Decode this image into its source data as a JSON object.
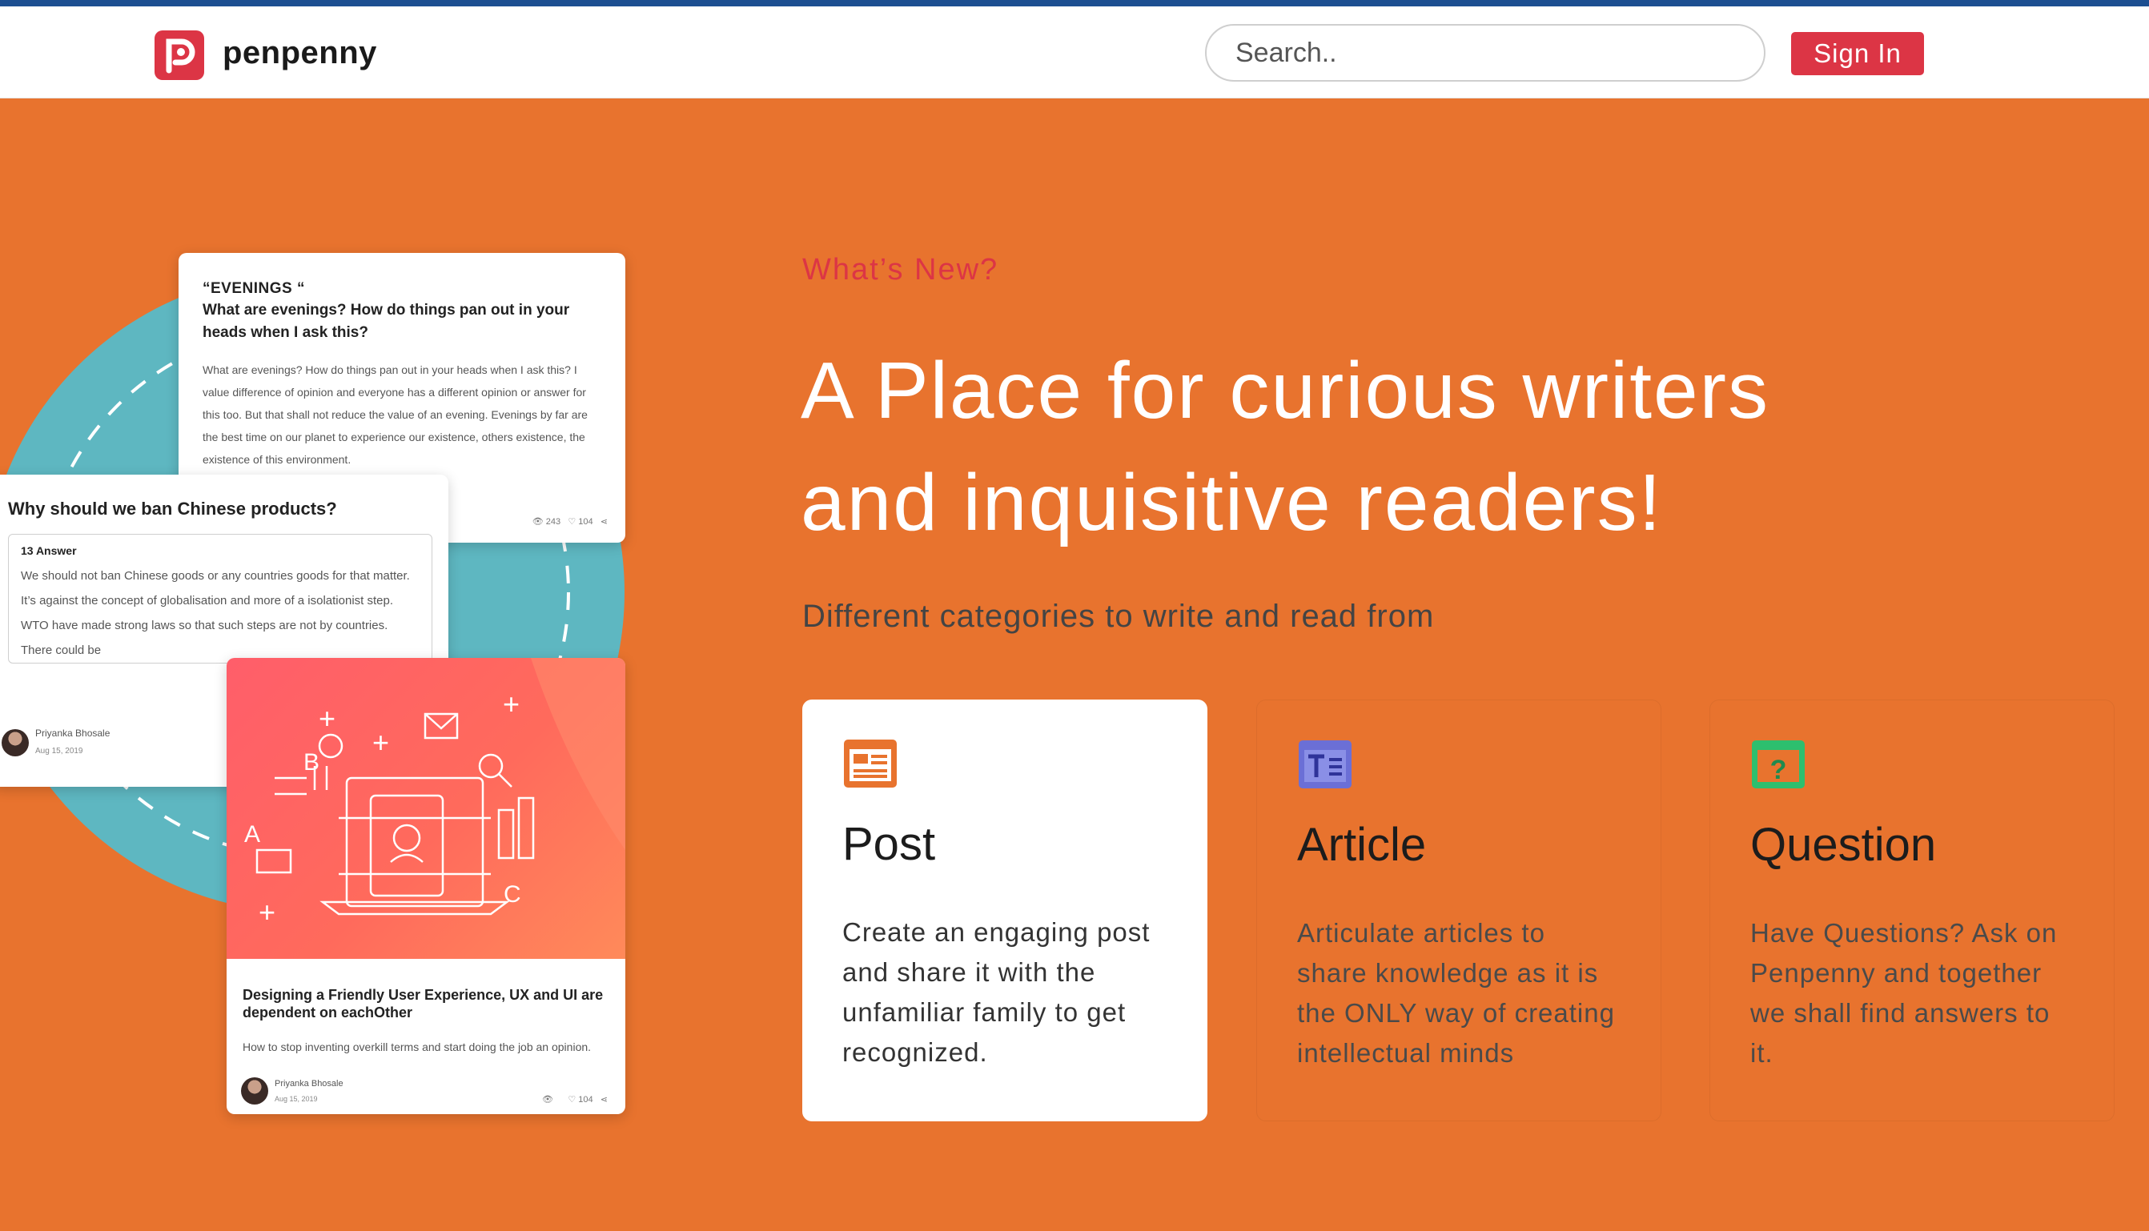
{
  "navbar": {
    "brand": "penpenny",
    "search_placeholder": "Search..",
    "signin_label": "Sign In"
  },
  "hero": {
    "kicker": "What’s New?",
    "headline_line1": "A Place for curious writers",
    "headline_line2": "and inquisitive readers!",
    "subhead": "Different categories to write and read from"
  },
  "preview_cards": {
    "evenings": {
      "kicker": "“EVENINGS “",
      "question": "What are evenings? How do things pan out in your heads when I ask this?",
      "body": "What are evenings? How do things pan out in your heads when I ask this? I value difference of opinion and everyone has a different opinion or answer for this too. But that shall not reduce the value of an evening. Evenings by far are the best time on our planet to experience our existence, others existence, the existence of this environment.",
      "views": "243",
      "likes": "104"
    },
    "chinese": {
      "question": "Why should we ban Chinese products?",
      "answer_count": "13 Answer",
      "answer": "We should not ban Chinese goods or any countries goods for that matter. It’s against the concept of globalisation and more of a isolationist step. WTO have made strong laws so that such steps are not by countries. There could be",
      "author": "Priyanka Bhosale",
      "date": "Aug 15, 2019"
    },
    "ux": {
      "title": "Designing a Friendly User Experience, UX and UI are dependent on eachOther",
      "desc": "How to stop inventing overkill terms and start doing the job an opinion.",
      "author": "Priyanka Bhosale",
      "date": "Aug 15, 2019",
      "likes": "104"
    }
  },
  "categories": [
    {
      "name": "Post",
      "icon": "post-icon",
      "color": "#e8732e",
      "text": "Create an engaging post and share it with the unfamiliar family to get recognized."
    },
    {
      "name": "Article",
      "icon": "article-icon",
      "color": "#6b6fd6",
      "text": "Articulate articles to share knowledge as it is the ONLY way of creating intellectual minds"
    },
    {
      "name": "Question",
      "icon": "question-icon",
      "color": "#2dbf6e",
      "text": "Have Questions? Ask on Penpenny and together we shall find answers to it."
    }
  ],
  "colors": {
    "background": "#e8732e",
    "accent_red": "#dc3545",
    "teal_blob": "#5eb7c1",
    "topline": "#1d4f91"
  }
}
